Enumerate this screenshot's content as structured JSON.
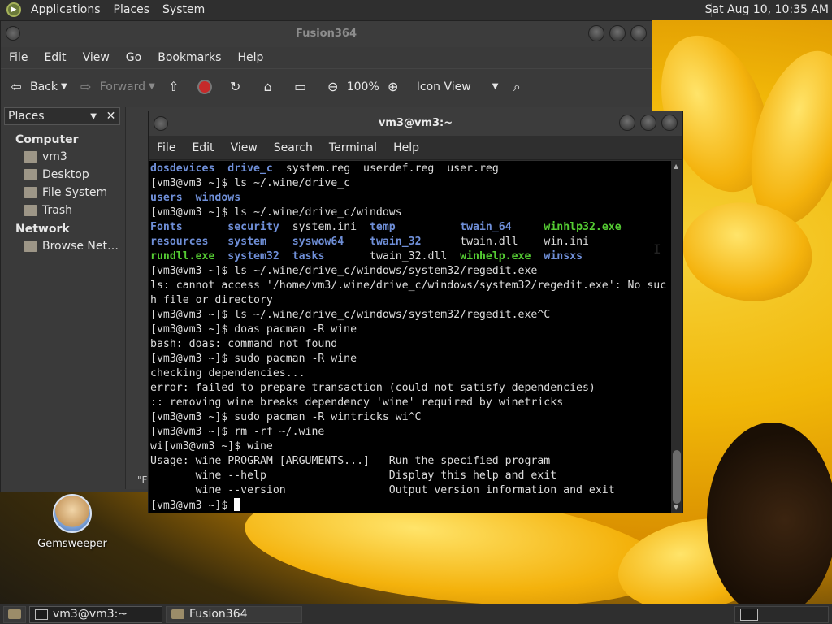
{
  "top_panel": {
    "menus": [
      "Applications",
      "Places",
      "System"
    ],
    "clock": "Sat Aug 10, 10:35 AM"
  },
  "bottom_panel": {
    "tasks": [
      "vm3@vm3:~",
      "Fusion364"
    ]
  },
  "desktop_icon": {
    "label": "Gemsweeper"
  },
  "file_manager": {
    "title": "Fusion364",
    "menu": [
      "File",
      "Edit",
      "View",
      "Go",
      "Bookmarks",
      "Help"
    ],
    "toolbar": {
      "back": "Back",
      "forward": "Forward",
      "zoom": "100%",
      "view_mode": "Icon View"
    },
    "sidebar": {
      "header": "Places",
      "sections": [
        {
          "title": "Computer",
          "items": [
            "vm3",
            "Desktop",
            "File System",
            "Trash"
          ]
        },
        {
          "title": "Network",
          "items": [
            "Browse Net…"
          ]
        }
      ]
    },
    "status_fragment": "\"F"
  },
  "terminal": {
    "title": "vm3@vm3:~",
    "menu": [
      "File",
      "Edit",
      "View",
      "Search",
      "Terminal",
      "Help"
    ],
    "colors": {
      "blue": "#6f8fd8",
      "green": "#55cc33",
      "fg": "#dcdcdc",
      "bg": "#000000"
    },
    "lines": [
      [
        [
          "dosdevices",
          "b"
        ],
        [
          "  ",
          "w"
        ],
        [
          "drive_c",
          "b"
        ],
        [
          "  system.reg  userdef.reg  user.reg",
          "w"
        ]
      ],
      [
        [
          "[vm3@vm3 ~]$ ls ~/.wine/drive_c",
          "w"
        ]
      ],
      [
        [
          "users",
          "b"
        ],
        [
          "  ",
          "w"
        ],
        [
          "windows",
          "b"
        ]
      ],
      [
        [
          "[vm3@vm3 ~]$ ls ~/.wine/drive_c/windows",
          "w"
        ]
      ],
      [
        [
          "Fonts",
          "b"
        ],
        [
          "       ",
          "w"
        ],
        [
          "security",
          "b"
        ],
        [
          "  system.ini  ",
          "w"
        ],
        [
          "temp",
          "b"
        ],
        [
          "          ",
          "w"
        ],
        [
          "twain_64",
          "b"
        ],
        [
          "     ",
          "w"
        ],
        [
          "winhlp32.exe",
          "g"
        ]
      ],
      [
        [
          "resources",
          "b"
        ],
        [
          "   ",
          "w"
        ],
        [
          "system",
          "b"
        ],
        [
          "    ",
          "w"
        ],
        [
          "syswow64",
          "b"
        ],
        [
          "    ",
          "w"
        ],
        [
          "twain_32",
          "b"
        ],
        [
          "      twain.dll    win.ini",
          "w"
        ]
      ],
      [
        [
          "rundll.exe",
          "g"
        ],
        [
          "  ",
          "w"
        ],
        [
          "system32",
          "b"
        ],
        [
          "  ",
          "w"
        ],
        [
          "tasks",
          "b"
        ],
        [
          "       twain_32.dll  ",
          "w"
        ],
        [
          "winhelp.exe",
          "g"
        ],
        [
          "  ",
          "w"
        ],
        [
          "winsxs",
          "b"
        ]
      ],
      [
        [
          "[vm3@vm3 ~]$ ls ~/.wine/drive_c/windows/system32/regedit.exe",
          "w"
        ]
      ],
      [
        [
          "ls: cannot access '/home/vm3/.wine/drive_c/windows/system32/regedit.exe': No suc",
          "w"
        ]
      ],
      [
        [
          "h file or directory",
          "w"
        ]
      ],
      [
        [
          "[vm3@vm3 ~]$ ls ~/.wine/drive_c/windows/system32/regedit.exe^C",
          "w"
        ]
      ],
      [
        [
          "[vm3@vm3 ~]$ doas pacman -R wine",
          "w"
        ]
      ],
      [
        [
          "bash: doas: command not found",
          "w"
        ]
      ],
      [
        [
          "[vm3@vm3 ~]$ sudo pacman -R wine",
          "w"
        ]
      ],
      [
        [
          "checking dependencies...",
          "w"
        ]
      ],
      [
        [
          "error: failed to prepare transaction (could not satisfy dependencies)",
          "w"
        ]
      ],
      [
        [
          ":: removing wine breaks dependency 'wine' required by winetricks",
          "w"
        ]
      ],
      [
        [
          "[vm3@vm3 ~]$ sudo pacman -R wintricks wi^C",
          "w"
        ]
      ],
      [
        [
          "[vm3@vm3 ~]$ rm -rf ~/.wine",
          "w"
        ]
      ],
      [
        [
          "wi[vm3@vm3 ~]$ wine",
          "w"
        ]
      ],
      [
        [
          "Usage: wine PROGRAM [ARGUMENTS...]   Run the specified program",
          "w"
        ]
      ],
      [
        [
          "       wine --help                   Display this help and exit",
          "w"
        ]
      ],
      [
        [
          "       wine --version                Output version information and exit",
          "w"
        ]
      ]
    ],
    "prompt": "[vm3@vm3 ~]$ "
  }
}
